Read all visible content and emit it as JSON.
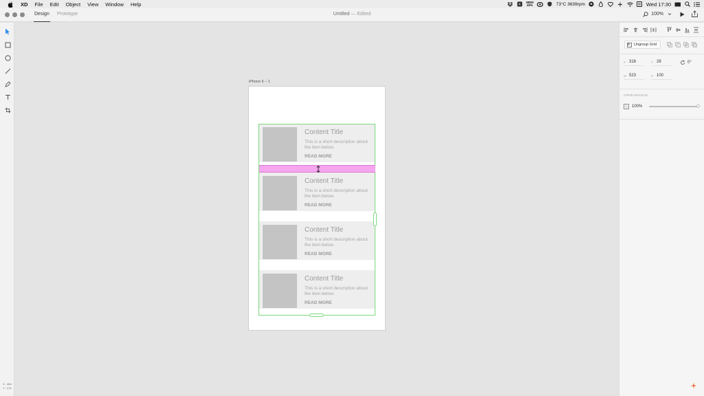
{
  "menubar": {
    "app_name": "XD",
    "menus": [
      "File",
      "Edit",
      "Object",
      "View",
      "Window",
      "Help"
    ],
    "status": {
      "mem_label": "MEM",
      "mem_value": "40%",
      "temperature": "73°C 3639rpm",
      "clock": "Wed 17:30"
    }
  },
  "titlebar": {
    "tabs": {
      "design": "Design",
      "prototype": "Prototype"
    },
    "doc_name": "Untitled",
    "doc_state": "— Edited",
    "zoom": "100%"
  },
  "toolbar": {
    "tools": [
      "select-tool",
      "rectangle-tool",
      "ellipse-tool",
      "line-tool",
      "pen-tool",
      "text-tool",
      "artboard-tool"
    ],
    "cursor_x": "X : 464",
    "cursor_y": "Y : 174"
  },
  "inspector": {
    "ungroup_label": "Ungroup Grid",
    "x_label": "X",
    "x_value": "318",
    "y_label": "Y",
    "y_value": "28",
    "rotation": "0°",
    "w_label": "W",
    "w_value": "523",
    "h_label": "H",
    "h_value": "100",
    "appearance_label": "APPEARANCE",
    "opacity": "100%",
    "opacity_level": 1.0
  },
  "artboard": {
    "name": "iPhone 6 – 1",
    "cards": [
      {
        "title": "Content Title",
        "description": "This is a short description about the item below.",
        "link": "READ MORE"
      },
      {
        "title": "Content Title",
        "description": "This is a short description about the item below.",
        "link": "READ MORE"
      },
      {
        "title": "Content Title",
        "description": "This is a short description about the item below.",
        "link": "READ MORE"
      },
      {
        "title": "Content Title",
        "description": "This is a short description about the item below.",
        "link": "READ MORE"
      }
    ]
  },
  "colors": {
    "selection": "#7ed97e",
    "gap_highlight": "#f5a6ee",
    "accent": "#2d8ceb"
  }
}
